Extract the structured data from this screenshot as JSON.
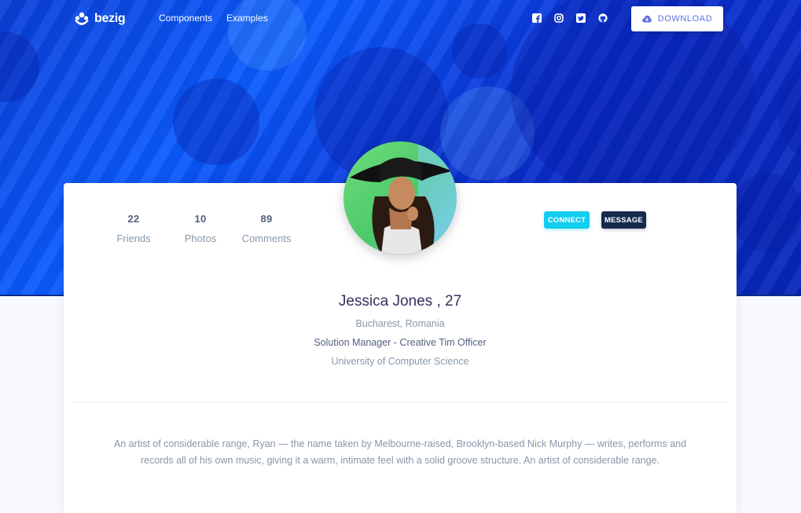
{
  "brand": {
    "name": "bezig"
  },
  "nav": {
    "links": [
      "Components",
      "Examples"
    ]
  },
  "social": [
    "facebook-icon",
    "instagram-icon",
    "twitter-icon",
    "github-icon"
  ],
  "download": {
    "label": "DOWNLOAD"
  },
  "stats": [
    {
      "value": "22",
      "label": "Friends"
    },
    {
      "value": "10",
      "label": "Photos"
    },
    {
      "value": "89",
      "label": "Comments"
    }
  ],
  "actions": {
    "connect": "CONNECT",
    "message": "MESSAGE"
  },
  "profile": {
    "name": "Jessica Jones , 27",
    "location": "Bucharest, Romania",
    "job": "Solution Manager - Creative Tim Officer",
    "education": "University of Computer Science",
    "bio": "An artist of considerable range, Ryan — the name taken by Melbourne-raised, Brooklyn-based Nick Murphy — writes, performs and records all of his own music, giving it a warm, intimate feel with a solid groove structure. An artist of considerable range."
  },
  "colors": {
    "accent": "#5e72e4",
    "info": "#11cdef",
    "dark": "#172b4d",
    "hero": "#0b4bff"
  }
}
